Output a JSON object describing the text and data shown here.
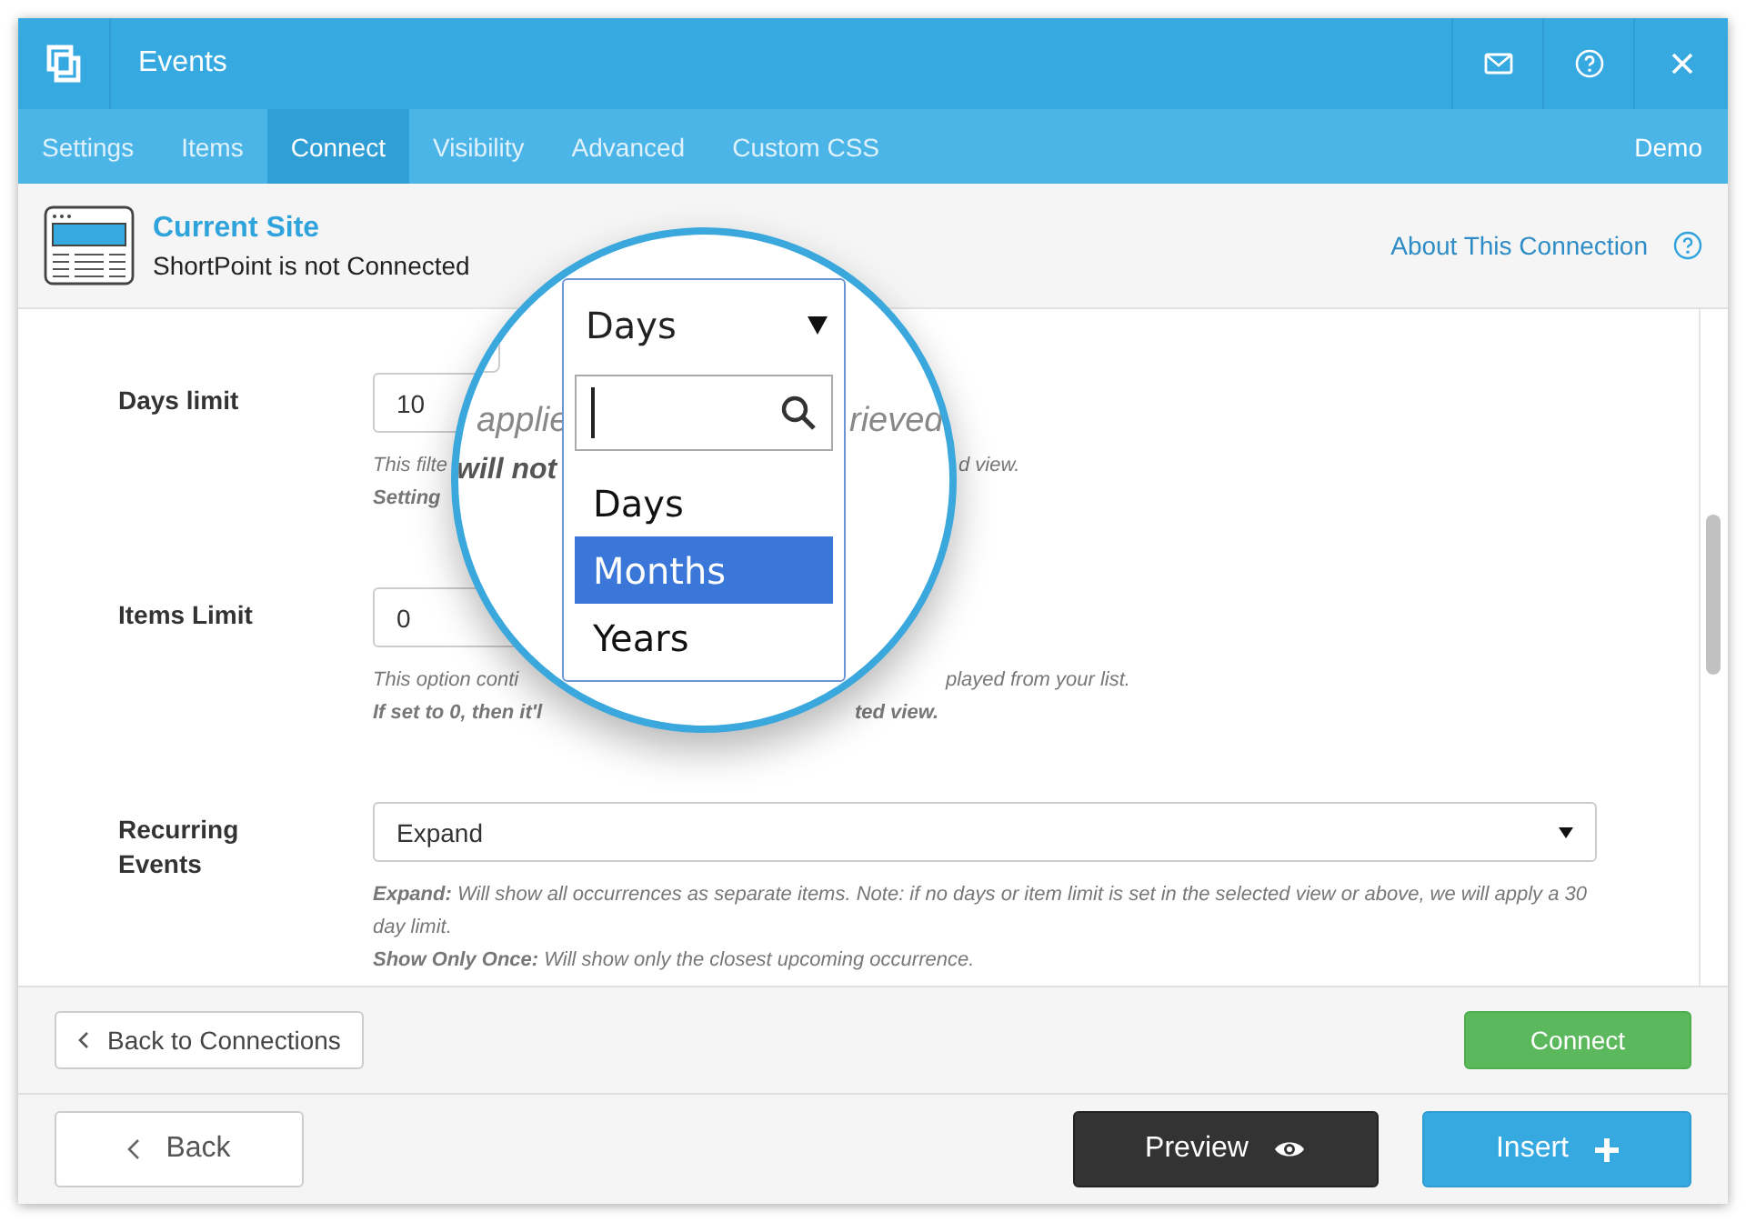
{
  "window": {
    "title": "Events"
  },
  "tabs": [
    {
      "label": "Settings",
      "selected": false
    },
    {
      "label": "Items",
      "selected": false
    },
    {
      "label": "Connect",
      "selected": true
    },
    {
      "label": "Visibility",
      "selected": false
    },
    {
      "label": "Advanced",
      "selected": false
    },
    {
      "label": "Custom CSS",
      "selected": false
    }
  ],
  "tabs_right": "Demo",
  "connection": {
    "title": "Current Site",
    "status": "ShortPoint is not Connected",
    "link": "About This Connection"
  },
  "fields": [
    {
      "label": "Days limit",
      "kind": "input",
      "value": "10",
      "hint_lines": [
        {
          "parts": [
            "This filte",
            "d view."
          ],
          "bold": false
        },
        {
          "parts": [
            "Setting"
          ],
          "bold": true
        }
      ]
    },
    {
      "label": "Items Limit",
      "kind": "input",
      "value": "0",
      "hint_lines": [
        {
          "parts": [
            "This option conti",
            "played from your list."
          ],
          "bold": false
        },
        {
          "parts": [
            "If set to 0, then it'l",
            "ted view."
          ],
          "bold": true
        }
      ]
    },
    {
      "label": "Recurring Events",
      "kind": "select",
      "value": "Expand",
      "hint_lines": [
        {
          "parts": [
            "**Expand:** Will show all occurrences as separate items. Note: if no days or item limit is set in the selected view or above, we will apply a 30 day limit."
          ],
          "bold": false
        },
        {
          "parts": [
            "**Show Only Once:** Will show only the closest upcoming occurrence."
          ],
          "bold": false
        }
      ]
    }
  ],
  "magnifier": {
    "behind_texts": [
      "applie",
      "rieved",
      "will not"
    ],
    "select_value": "Days",
    "options": [
      {
        "label": "Days",
        "selected": false
      },
      {
        "label": "Months",
        "selected": true
      },
      {
        "label": "Years",
        "selected": false
      }
    ]
  },
  "footer": {
    "back_connections": "Back to Connections",
    "connect": "Connect"
  },
  "actions": {
    "back": "Back",
    "preview": "Preview",
    "insert": "Insert"
  }
}
